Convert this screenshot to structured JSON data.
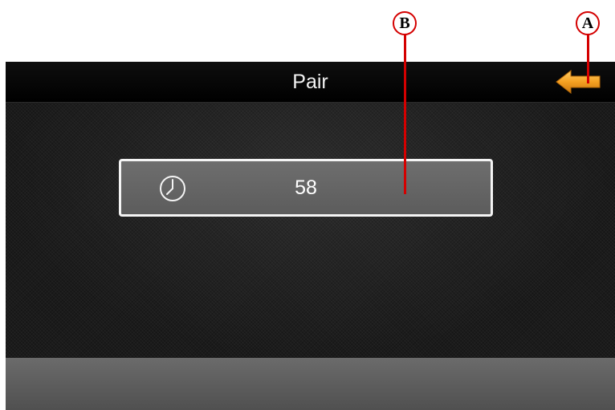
{
  "header": {
    "title": "Pair",
    "back_icon": "back-arrow-icon"
  },
  "timer": {
    "icon": "clock-icon",
    "value": "58"
  },
  "callouts": {
    "a_label": "A",
    "b_label": "B"
  },
  "colors": {
    "back_arrow": "#f5a021",
    "callout": "#d40000"
  }
}
